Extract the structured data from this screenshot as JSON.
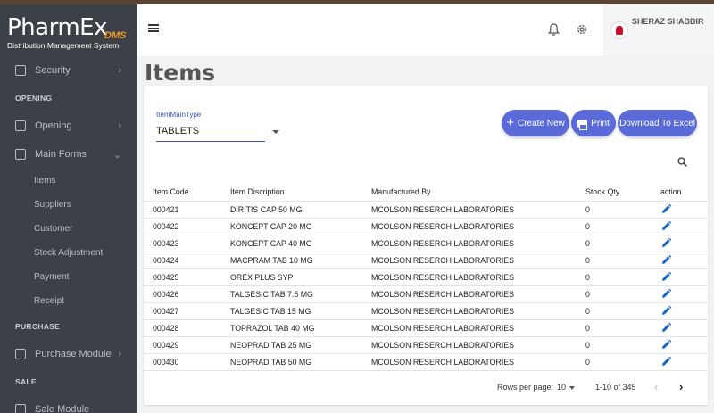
{
  "app": {
    "logo_main": "PharmEx",
    "logo_dms": "DMS",
    "logo_sub": "Distribution Management System"
  },
  "user": {
    "name": "SHERAZ SHABBIR"
  },
  "page": {
    "title": "Items"
  },
  "sidebar": {
    "security": "Security",
    "head_opening": "OPENING",
    "opening": "Opening",
    "main_forms": "Main Forms",
    "sub": [
      "Items",
      "Suppliers",
      "Customer",
      "Stock Adjustment",
      "Payment",
      "Receipt"
    ],
    "head_purchase": "PURCHASE",
    "purchase_module": "Purchase Module",
    "head_sale": "SALE",
    "sale_module": "Sale Module"
  },
  "filter": {
    "label": "ItemMainType",
    "value": "TABLETS"
  },
  "buttons": {
    "create": "Create New",
    "print": "Print",
    "excel": "Download To Excel"
  },
  "table": {
    "headers": [
      "Item Code",
      "Item Discription",
      "Manufactured By",
      "Stock Qty",
      "action"
    ],
    "rows": [
      [
        "000421",
        "DIRITIS CAP 50 MG",
        "MCOLSON RESERCH LABORATORIES",
        "0"
      ],
      [
        "000422",
        "KONCEPT CAP 20 MG",
        "MCOLSON RESERCH LABORATORIES",
        "0"
      ],
      [
        "000423",
        "KONCEPT CAP 40 MG",
        "MCOLSON RESERCH LABORATORIES",
        "0"
      ],
      [
        "000424",
        "MACPRAM TAB 10 MG",
        "MCOLSON RESERCH LABORATORIES",
        "0"
      ],
      [
        "000425",
        "OREX PLUS SYP",
        "MCOLSON RESERCH LABORATORIES",
        "0"
      ],
      [
        "000426",
        "TALGESIC TAB 7.5 MG",
        "MCOLSON RESERCH LABORATORIES",
        "0"
      ],
      [
        "000427",
        "TALGESIC TAB 15 MG",
        "MCOLSON RESERCH LABORATORIES",
        "0"
      ],
      [
        "000428",
        "TOPRAZOL TAB 40 MG",
        "MCOLSON RESERCH LABORATORIES",
        "0"
      ],
      [
        "000429",
        "NEOPRAD TAB 25 MG",
        "MCOLSON RESERCH LABORATORIES",
        "0"
      ],
      [
        "000430",
        "NEOPRAD TAB 50 MG",
        "MCOLSON RESERCH LABORATORIES",
        "0"
      ]
    ]
  },
  "pager": {
    "rows_label": "Rows per page:",
    "rows_value": "10",
    "range": "1-10 of 345"
  },
  "colors": {
    "accent": "#5a6bd9",
    "sidebar": "#3b4146",
    "pencil": "#1565c0"
  },
  "icons": [
    "hamburger-icon",
    "bell-icon",
    "gear-icon",
    "search-icon",
    "pencil-icon",
    "plus-icon",
    "printer-icon"
  ]
}
